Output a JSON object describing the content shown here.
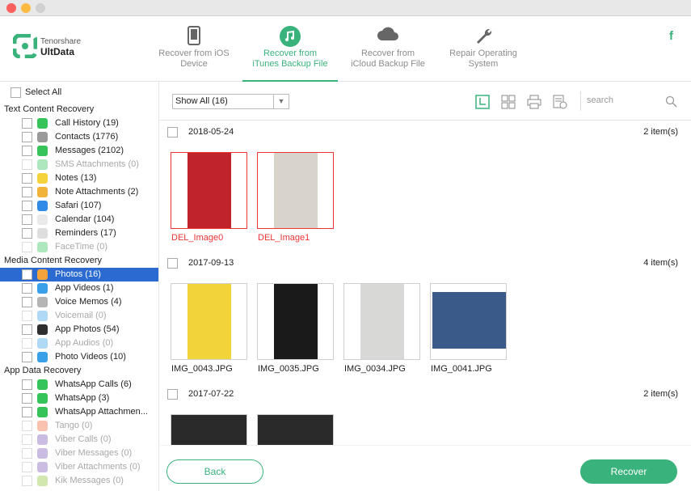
{
  "brand": {
    "line1": "Tenorshare",
    "line2": "UltData",
    "facebook": "f"
  },
  "tabs": [
    {
      "label": "Recover from iOS\nDevice",
      "icon": "phone-icon"
    },
    {
      "label": "Recover from\niTunes Backup File",
      "icon": "music-note-icon",
      "active": true
    },
    {
      "label": "Recover from\niCloud Backup File",
      "icon": "cloud-icon"
    },
    {
      "label": "Repair Operating\nSystem",
      "icon": "wrench-icon"
    }
  ],
  "sidebar": {
    "select_all": "Select All",
    "sections": [
      {
        "title": "Text Content Recovery",
        "items": [
          {
            "label": "Call History (19)",
            "icon": "phone-icon",
            "color": "#35c35a",
            "dim": false
          },
          {
            "label": "Contacts (1776)",
            "icon": "contacts-icon",
            "color": "#9a9a9a",
            "dim": false
          },
          {
            "label": "Messages (2102)",
            "icon": "message-icon",
            "color": "#35c35a",
            "dim": false
          },
          {
            "label": "SMS Attachments (0)",
            "icon": "paperclip-icon",
            "color": "#35c35a",
            "dim": true
          },
          {
            "label": "Notes (13)",
            "icon": "notes-icon",
            "color": "#f5d33c",
            "dim": false
          },
          {
            "label": "Note Attachments (2)",
            "icon": "paperclip-icon",
            "color": "#f0b43a",
            "dim": false
          },
          {
            "label": "Safari (107)",
            "icon": "compass-icon",
            "color": "#2f8be6",
            "dim": false
          },
          {
            "label": "Calendar (104)",
            "icon": "calendar-icon",
            "color": "#e9e9e9",
            "dim": false
          },
          {
            "label": "Reminders (17)",
            "icon": "list-icon",
            "color": "#dedede",
            "dim": false
          },
          {
            "label": "FaceTime (0)",
            "icon": "video-icon",
            "color": "#35c35a",
            "dim": true
          }
        ]
      },
      {
        "title": "Media Content Recovery",
        "items": [
          {
            "label": "Photos (16)",
            "icon": "photos-icon",
            "color": "#f3a23c",
            "dim": false,
            "selected": true
          },
          {
            "label": "App Videos (1)",
            "icon": "film-icon",
            "color": "#3aa0e8",
            "dim": false
          },
          {
            "label": "Voice Memos (4)",
            "icon": "waveform-icon",
            "color": "#b5b5b5",
            "dim": false
          },
          {
            "label": "Voicemail (0)",
            "icon": "voicemail-icon",
            "color": "#3aa0e8",
            "dim": true
          },
          {
            "label": "App Photos (54)",
            "icon": "landscape-icon",
            "color": "#2f2f2f",
            "dim": false
          },
          {
            "label": "App Audios (0)",
            "icon": "music-icon",
            "color": "#3aa0e8",
            "dim": true
          },
          {
            "label": "Photo Videos (10)",
            "icon": "video-file-icon",
            "color": "#3aa0e8",
            "dim": false
          }
        ]
      },
      {
        "title": "App Data Recovery",
        "items": [
          {
            "label": "WhatsApp Calls (6)",
            "icon": "whatsapp-icon",
            "color": "#35c35a",
            "dim": false
          },
          {
            "label": "WhatsApp (3)",
            "icon": "whatsapp-icon",
            "color": "#35c35a",
            "dim": false
          },
          {
            "label": "WhatsApp Attachmen...",
            "icon": "paperclip-icon",
            "color": "#35c35a",
            "dim": false
          },
          {
            "label": "Tango (0)",
            "icon": "tango-icon",
            "color": "#f0643a",
            "dim": true
          },
          {
            "label": "Viber Calls (0)",
            "icon": "viber-icon",
            "color": "#7d5ab5",
            "dim": true
          },
          {
            "label": "Viber Messages (0)",
            "icon": "viber-icon",
            "color": "#7d5ab5",
            "dim": true
          },
          {
            "label": "Viber Attachments (0)",
            "icon": "paperclip-icon",
            "color": "#7d5ab5",
            "dim": true
          },
          {
            "label": "Kik Messages (0)",
            "icon": "kik-icon",
            "color": "#8fc33a",
            "dim": true
          }
        ]
      }
    ]
  },
  "toolbar": {
    "filter_value": "Show All (16)",
    "search_placeholder": "search"
  },
  "groups": [
    {
      "date": "2018-05-24",
      "count": "2 item(s)",
      "items": [
        {
          "name": "DEL_Image0",
          "deleted": true,
          "bg": "#c0242a"
        },
        {
          "name": "DEL_Image1",
          "deleted": true,
          "bg": "#d8d4cc"
        }
      ]
    },
    {
      "date": "2017-09-13",
      "count": "4 item(s)",
      "items": [
        {
          "name": "IMG_0043.JPG",
          "deleted": false,
          "bg": "#f2d33a"
        },
        {
          "name": "IMG_0035.JPG",
          "deleted": false,
          "bg": "#1a1a1a"
        },
        {
          "name": "IMG_0034.JPG",
          "deleted": false,
          "bg": "#d8d8d6"
        },
        {
          "name": "IMG_0041.JPG",
          "deleted": false,
          "bg": "#3a5a8a"
        }
      ]
    },
    {
      "date": "2017-07-22",
      "count": "2 item(s)",
      "items": [
        {
          "name": "",
          "deleted": false,
          "bg": "#2a2a2a"
        },
        {
          "name": "",
          "deleted": false,
          "bg": "#2a2a2a"
        }
      ]
    }
  ],
  "footer": {
    "back": "Back",
    "recover": "Recover"
  },
  "colors": {
    "accent": "#3ab27c",
    "selection": "#2b6bd1",
    "deleted": "#e33333"
  }
}
